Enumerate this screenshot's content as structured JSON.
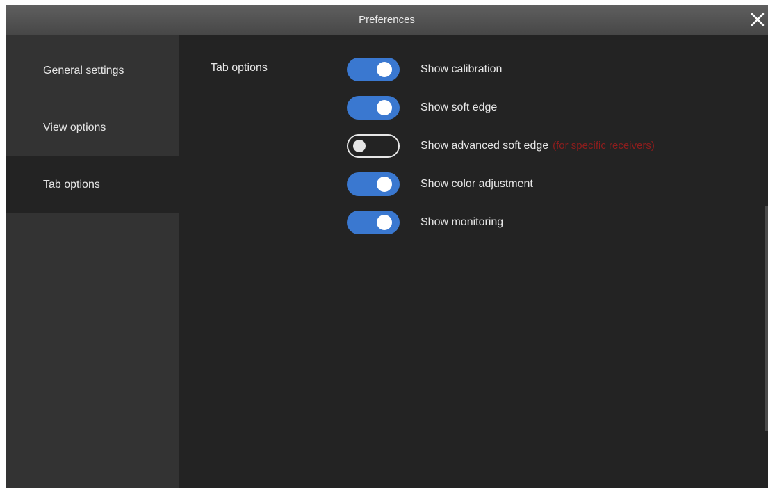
{
  "window": {
    "title": "Preferences",
    "close_icon": "close-icon"
  },
  "sidebar": {
    "items": [
      {
        "label": "General settings",
        "active": false
      },
      {
        "label": "View options",
        "active": false
      },
      {
        "label": "Tab options",
        "active": true
      }
    ]
  },
  "main": {
    "section_label": "Tab options",
    "options": [
      {
        "label": "Show calibration",
        "on": true,
        "note": ""
      },
      {
        "label": "Show soft edge",
        "on": true,
        "note": ""
      },
      {
        "label": "Show advanced soft edge",
        "on": false,
        "note": "(for specific receivers)"
      },
      {
        "label": "Show color adjustment",
        "on": true,
        "note": ""
      },
      {
        "label": "Show monitoring",
        "on": true,
        "note": ""
      }
    ]
  },
  "colors": {
    "accent": "#3a78d0",
    "note": "#8e1d1d",
    "background": "#232323",
    "sidebar": "#333333"
  }
}
